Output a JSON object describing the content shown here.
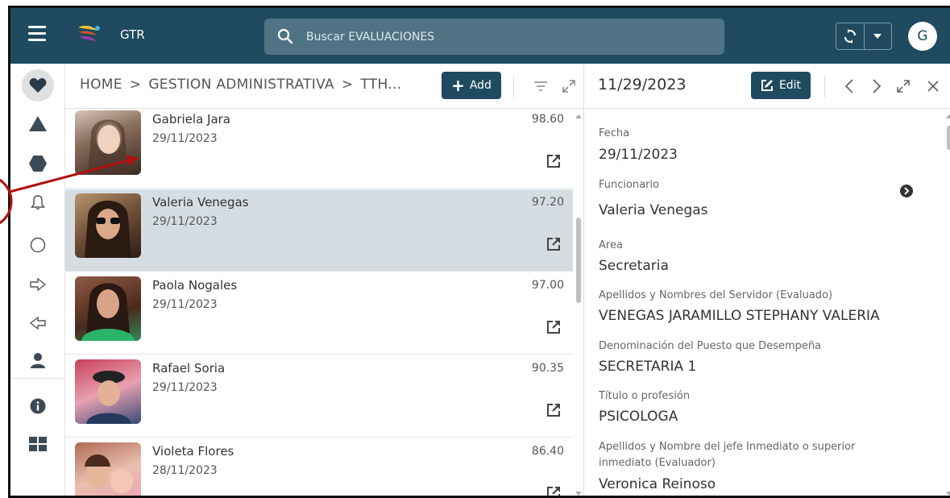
{
  "topbar": {
    "app_title": "GTR",
    "search_placeholder": "Buscar EVALUACIONES",
    "user_initial": "G",
    "colors": {
      "bar": "#1f4a5f",
      "search_bg": "#4f7384"
    }
  },
  "rail": {
    "icons": [
      "heart-icon",
      "triangle-icon",
      "hexagon-icon",
      "bell-icon",
      "circle-icon",
      "arrow-right-icon",
      "arrow-left-icon",
      "user-icon",
      "info-icon",
      "grid-icon"
    ]
  },
  "list": {
    "breadcrumb": [
      "HOME",
      "GESTION ADMINISTRATIVA",
      "TTH..."
    ],
    "breadcrumb_sep": ">",
    "add_label": "Add",
    "rows": [
      {
        "name": "Gabriela Jara",
        "date": "29/11/2023",
        "score": "98.60"
      },
      {
        "name": "Valeria Venegas",
        "date": "29/11/2023",
        "score": "97.20"
      },
      {
        "name": "Paola Nogales",
        "date": "29/11/2023",
        "score": "97.00"
      },
      {
        "name": "Rafael Soria",
        "date": "29/11/2023",
        "score": "90.35"
      },
      {
        "name": "Violeta Flores",
        "date": "28/11/2023",
        "score": "86.40"
      }
    ],
    "selected_index": 1
  },
  "detail": {
    "header_date": "11/29/2023",
    "edit_label": "Edit",
    "fields": [
      {
        "label": "Fecha",
        "value": "29/11/2023"
      },
      {
        "label": "Funcionario",
        "value": "Valeria Venegas"
      },
      {
        "label": "Area",
        "value": "Secretaria"
      },
      {
        "label": "Apellidos y Nombres del Servidor (Evaluado)",
        "value": "VENEGAS JARAMILLO STEPHANY VALERIA"
      },
      {
        "label": "Denominación del Puesto que Desempeña",
        "value": "SECRETARIA 1"
      },
      {
        "label": "Título o profesión",
        "value": "PSICOLOGA"
      },
      {
        "label_line1": "Apellidos y Nombre del jefe Inmediato o superior",
        "label_line2": "inmediato (Evaluador)",
        "value": "Veronica Reinoso"
      }
    ]
  }
}
